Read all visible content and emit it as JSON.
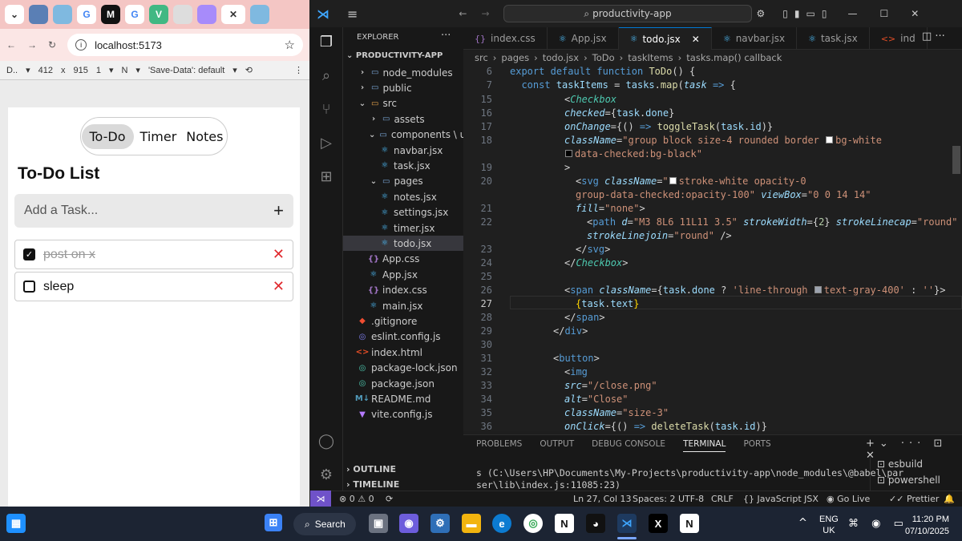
{
  "browser": {
    "tabs": [
      "",
      "",
      "G",
      "M",
      "G",
      "V",
      "",
      ""
    ],
    "url": "localhost:5173",
    "devtools": {
      "device": "D..",
      "width": "412",
      "times": "x",
      "height": "915",
      "zoom": "1",
      "throttle": "N",
      "save_data": "'Save-Data': default"
    }
  },
  "app": {
    "nav": [
      "To-Do",
      "Timer",
      "Notes"
    ],
    "title": "To-Do List",
    "add_placeholder": "Add a Task...",
    "tasks": [
      {
        "text": "post on x",
        "done": true
      },
      {
        "text": "sleep",
        "done": false
      }
    ]
  },
  "vscode": {
    "search": "productivity-app",
    "explorer_title": "EXPLORER",
    "project": "PRODUCTIVITY-APP",
    "tree": [
      {
        "name": "node_modules",
        "depth": 1,
        "type": "folder-closed"
      },
      {
        "name": "public",
        "depth": 1,
        "type": "folder-closed"
      },
      {
        "name": "src",
        "depth": 1,
        "type": "folder-open"
      },
      {
        "name": "assets",
        "depth": 2,
        "type": "folder-closed"
      },
      {
        "name": "components \\ ui",
        "depth": 2,
        "type": "folder-open"
      },
      {
        "name": "navbar.jsx",
        "depth": 3,
        "type": "react"
      },
      {
        "name": "task.jsx",
        "depth": 3,
        "type": "react"
      },
      {
        "name": "pages",
        "depth": 2,
        "type": "folder-open"
      },
      {
        "name": "notes.jsx",
        "depth": 3,
        "type": "react"
      },
      {
        "name": "settings.jsx",
        "depth": 3,
        "type": "react"
      },
      {
        "name": "timer.jsx",
        "depth": 3,
        "type": "react"
      },
      {
        "name": "todo.jsx",
        "depth": 3,
        "type": "react",
        "selected": true
      },
      {
        "name": "App.css",
        "depth": 2,
        "type": "css"
      },
      {
        "name": "App.jsx",
        "depth": 2,
        "type": "react"
      },
      {
        "name": "index.css",
        "depth": 2,
        "type": "css"
      },
      {
        "name": "main.jsx",
        "depth": 2,
        "type": "react"
      },
      {
        "name": ".gitignore",
        "depth": 1,
        "type": "git"
      },
      {
        "name": "eslint.config.js",
        "depth": 1,
        "type": "eslint"
      },
      {
        "name": "index.html",
        "depth": 1,
        "type": "html"
      },
      {
        "name": "package-lock.json",
        "depth": 1,
        "type": "npm"
      },
      {
        "name": "package.json",
        "depth": 1,
        "type": "npm"
      },
      {
        "name": "README.md",
        "depth": 1,
        "type": "md"
      },
      {
        "name": "vite.config.js",
        "depth": 1,
        "type": "vite"
      }
    ],
    "outline": "OUTLINE",
    "timeline": "TIMELINE",
    "editor_tabs": [
      {
        "label": "index.css",
        "icon": "{}"
      },
      {
        "label": "App.jsx",
        "icon": "react"
      },
      {
        "label": "todo.jsx",
        "icon": "react",
        "active": true
      },
      {
        "label": "navbar.jsx",
        "icon": "react"
      },
      {
        "label": "task.jsx",
        "icon": "react"
      },
      {
        "label": "ind",
        "icon": "html"
      }
    ],
    "breadcrumb": [
      "src",
      "pages",
      "todo.jsx",
      "ToDo",
      "taskItems",
      "tasks.map() callback"
    ],
    "line_numbers": [
      "6",
      "7",
      "15",
      "16",
      "17",
      "18",
      "",
      "19",
      "20",
      "",
      "21",
      "22",
      "",
      "23",
      "24",
      "25",
      "26",
      "27",
      "28",
      "29",
      "30",
      "31",
      "32",
      "33",
      "34",
      "35",
      "36"
    ],
    "panel_tabs": [
      "PROBLEMS",
      "OUTPUT",
      "DEBUG CONSOLE",
      "TERMINAL",
      "PORTS"
    ],
    "terminal_lines": [
      "s (C:\\Users\\HP\\Documents\\My-Projects\\productivity-app\\node_modules\\@babel\\par",
      "ser\\lib\\index.js:11085:23)"
    ],
    "terminals": [
      "esbuild",
      "powershell"
    ],
    "status": {
      "errors": "0",
      "warnings": "0",
      "position": "Ln 27, Col 13",
      "spaces": "Spaces: 2",
      "encoding": "UTF-8",
      "eol": "CRLF",
      "language": "JavaScript JSX",
      "golive": "Go Live",
      "prettier": "Prettier"
    }
  },
  "taskbar": {
    "search": "Search",
    "lang1": "ENG",
    "lang2": "UK",
    "time": "11:20 PM",
    "date": "07/10/2025"
  },
  "colors": {
    "accent": "#0078d4",
    "chrome_tab_bg": "#f4c6c4",
    "delete_red": "#e0292e",
    "remote_purple": "#6f52c9"
  }
}
